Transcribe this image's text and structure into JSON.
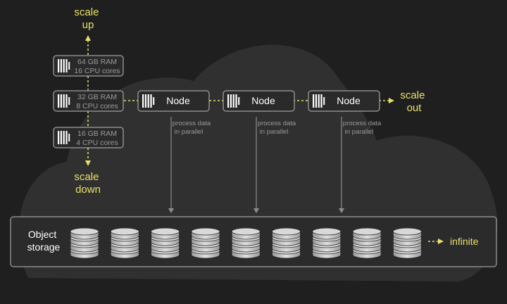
{
  "scale_up": [
    "scale",
    "up"
  ],
  "scale_down": [
    "scale",
    "down"
  ],
  "scale_out": [
    "scale",
    "out"
  ],
  "vertical_sizes": [
    {
      "ram": "64 GB RAM",
      "cpu": "16 CPU cores"
    },
    {
      "ram": "32 GB RAM",
      "cpu": "8 CPU cores"
    },
    {
      "ram": "16 GB RAM",
      "cpu": "4 CPU cores"
    }
  ],
  "node_label": "Node",
  "nodes_count": 3,
  "parallel_label": [
    "process data",
    "in parallel"
  ],
  "storage_label": [
    "Object",
    "storage"
  ],
  "disks_count": 9,
  "infinite_label": "infinite",
  "colors": {
    "background": "#1f1f1f",
    "cloud": "#303030",
    "accent": "#e8e06a",
    "box_border": "#bdbdbd",
    "box_fill": "#2a2a2a",
    "muted_text": "#9a9a9a",
    "arrow": "#8c8c8c"
  }
}
